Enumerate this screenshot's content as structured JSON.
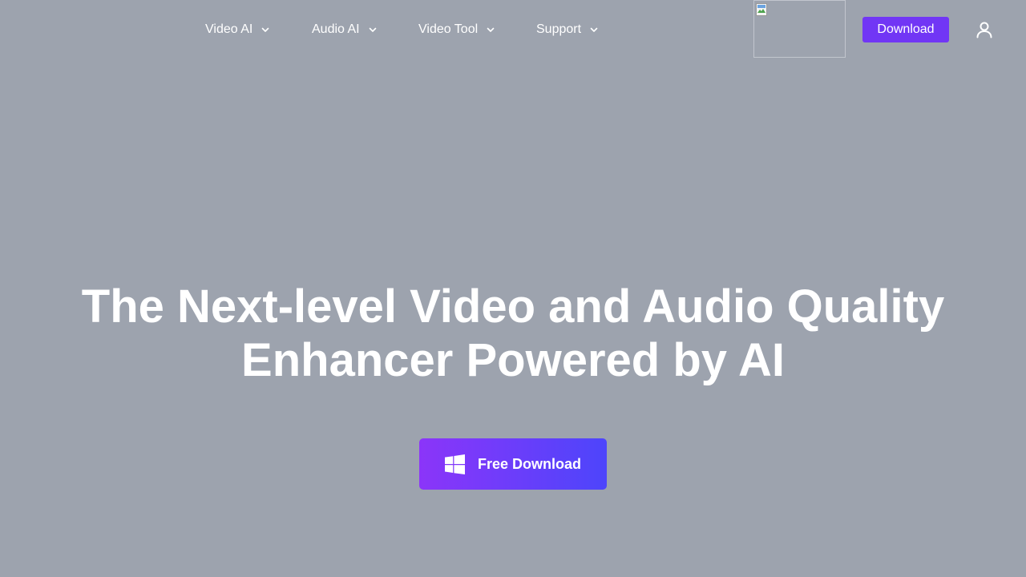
{
  "nav": {
    "items": [
      {
        "label": "Video AI",
        "icon": "chevron-down-icon"
      },
      {
        "label": "Audio AI",
        "icon": "chevron-down-icon"
      },
      {
        "label": "Video Tool",
        "icon": "chevron-down-icon"
      },
      {
        "label": "Support",
        "icon": "chevron-down-icon"
      }
    ],
    "image_icon": "broken-image-icon",
    "download_label": "Download",
    "user_icon": "user-icon"
  },
  "hero": {
    "title_line1": "The Next-level Video and Audio Quality",
    "title_line2": "Enhancer Powered by AI",
    "cta_label": "Free Download",
    "cta_icon": "windows-icon"
  },
  "colors": {
    "background": "#9da3ae",
    "accent": "#7136f5",
    "cta_gradient_start": "#8b35f9",
    "cta_gradient_end": "#4d45fb",
    "text": "#ffffff"
  }
}
